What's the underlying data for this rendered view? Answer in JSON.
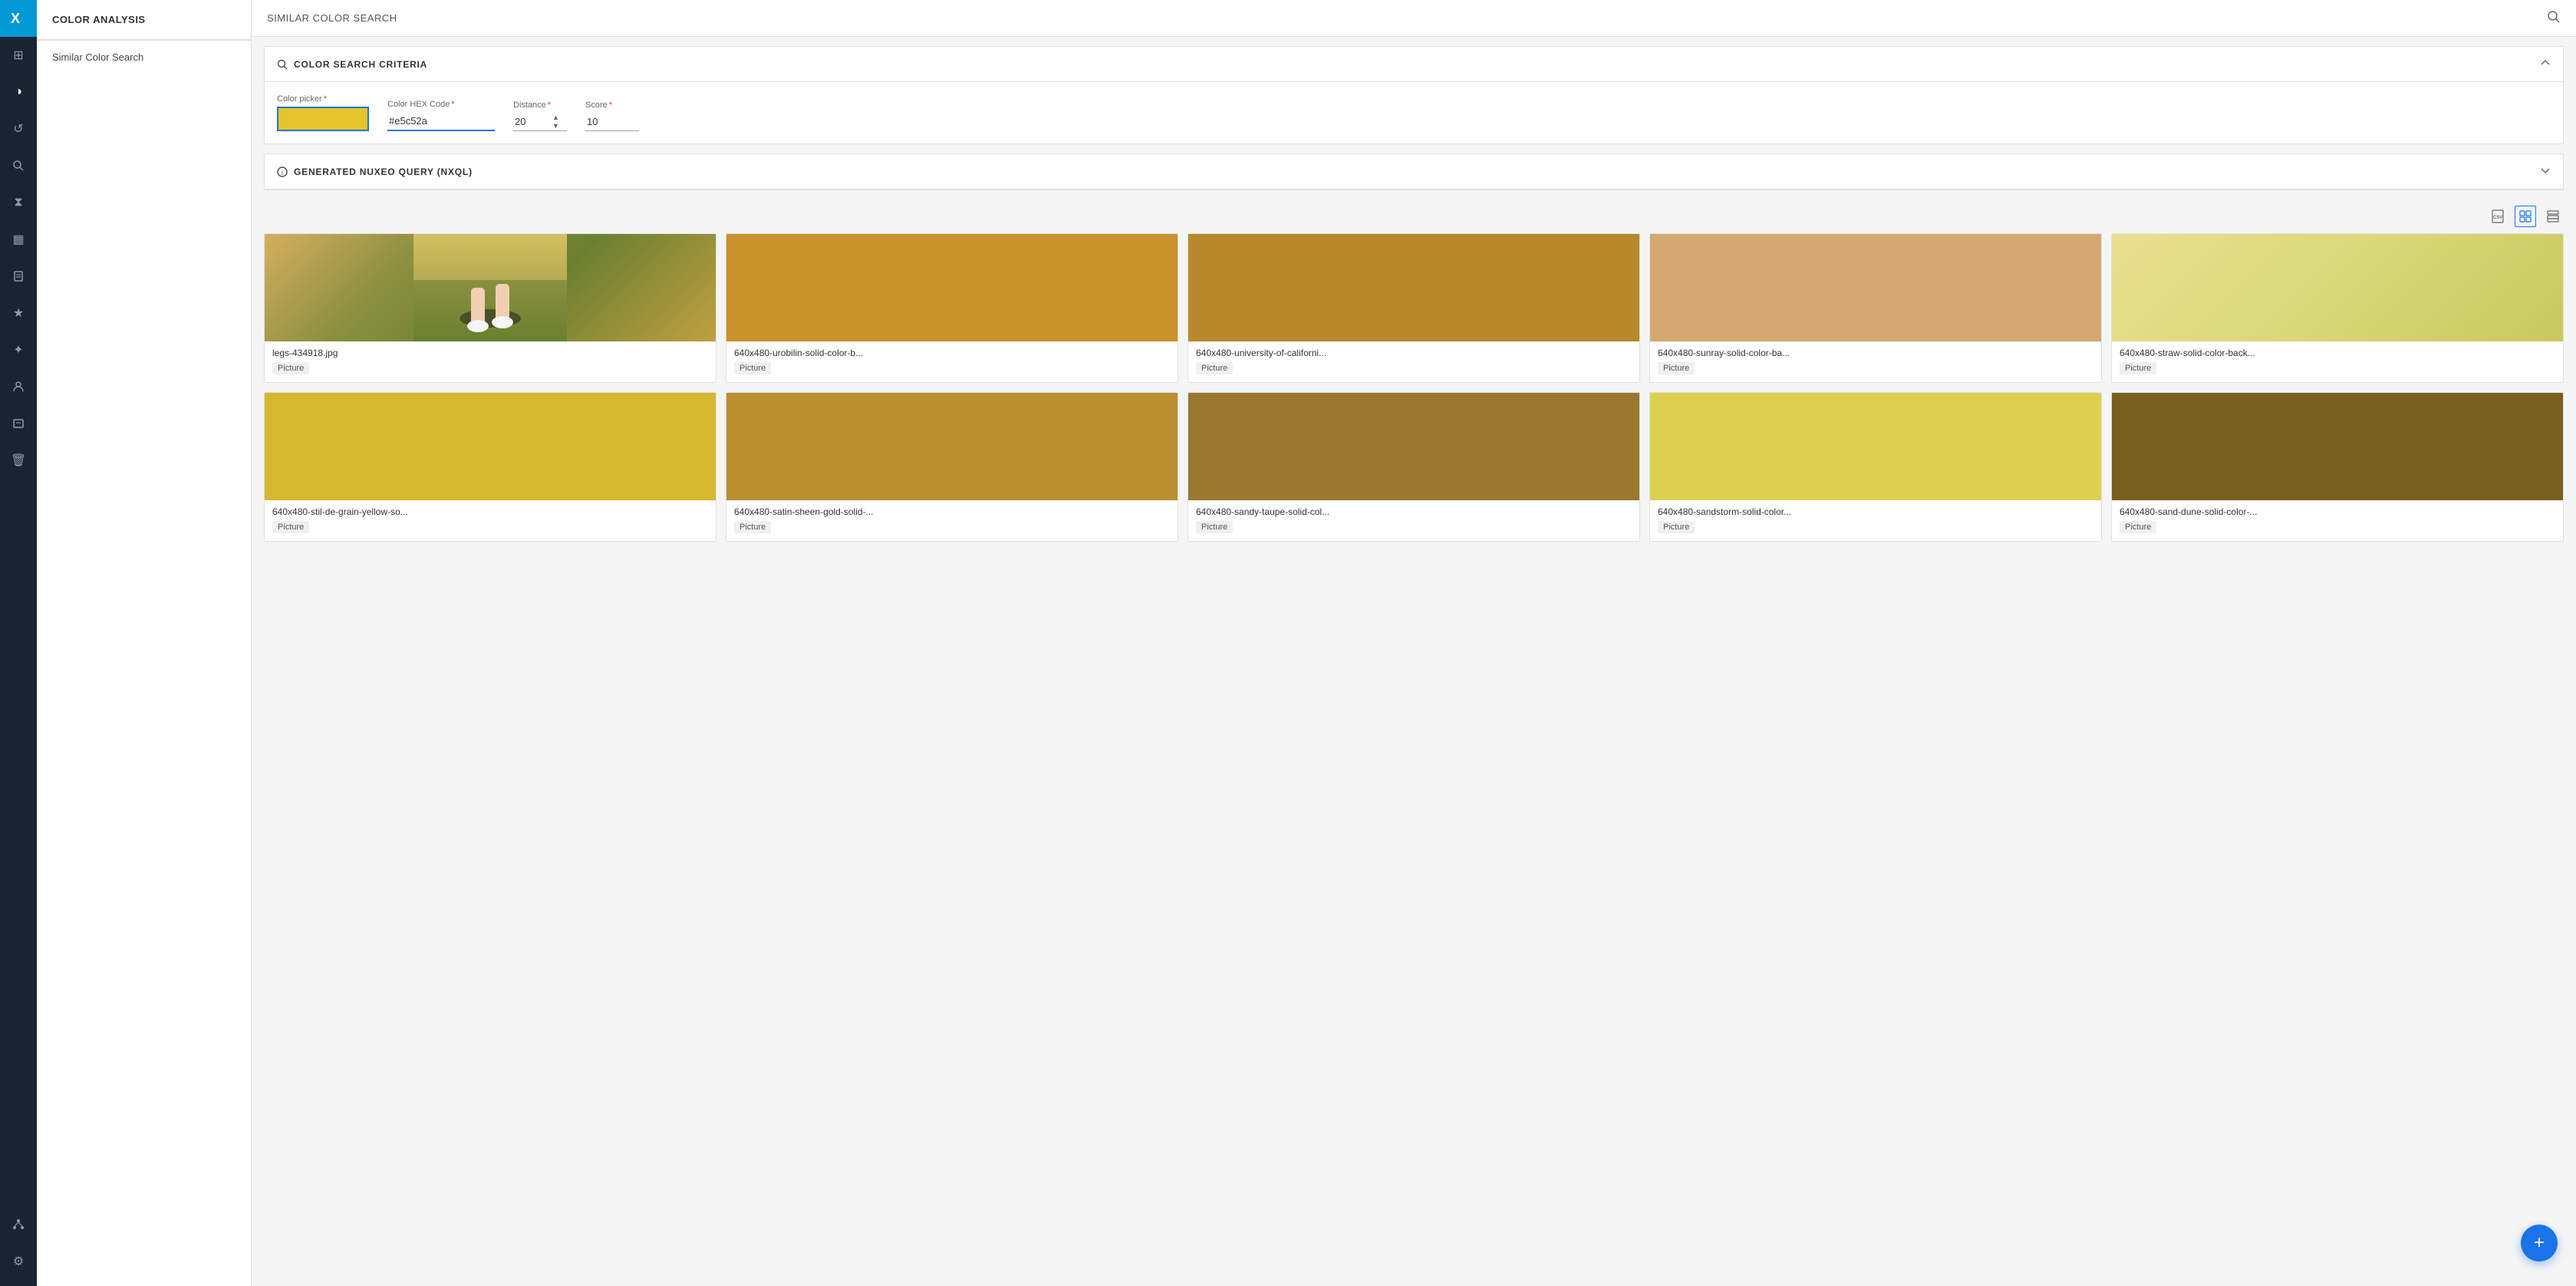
{
  "app": {
    "title": "COLOR ANALYSIS",
    "header_search_icon": "🔍"
  },
  "header": {
    "title": "SIMILAR COLOR SEARCH"
  },
  "sidebar": {
    "title": "COLOR ANALYSIS",
    "items": [
      {
        "label": "Similar Color Search",
        "active": true
      }
    ]
  },
  "nav": {
    "icons": [
      {
        "name": "home-icon",
        "glyph": "⊞",
        "active": false
      },
      {
        "name": "contrast-icon",
        "glyph": "◑",
        "active": true
      },
      {
        "name": "history-icon",
        "glyph": "↺",
        "active": false
      },
      {
        "name": "search-icon",
        "glyph": "🔍",
        "active": false
      },
      {
        "name": "timer-icon",
        "glyph": "⧗",
        "active": false
      },
      {
        "name": "gallery-icon",
        "glyph": "▦",
        "active": false
      },
      {
        "name": "clipboard-icon",
        "glyph": "📋",
        "active": false
      },
      {
        "name": "star-icon",
        "glyph": "★",
        "active": false
      },
      {
        "name": "network-icon",
        "glyph": "✦",
        "active": false
      },
      {
        "name": "user-icon",
        "glyph": "👤",
        "active": false
      },
      {
        "name": "badge-icon",
        "glyph": "🪪",
        "active": false
      },
      {
        "name": "trash-icon",
        "glyph": "🗑",
        "active": false
      }
    ],
    "bottom_icons": [
      {
        "name": "hierarchy-icon",
        "glyph": "⬡"
      },
      {
        "name": "settings-icon",
        "glyph": "⚙"
      }
    ]
  },
  "criteria_section": {
    "title": "COLOR SEARCH CRITERIA",
    "fields": {
      "color_picker_label": "Color picker",
      "color_hex_label": "Color HEX Code",
      "distance_label": "Distance",
      "score_label": "Score",
      "color_value": "#e5c52a",
      "hex_value": "#e5c52a",
      "distance_value": "20",
      "score_value": "10"
    }
  },
  "query_section": {
    "title": "GENERATED NUXEO QUERY (NXQL)"
  },
  "results": {
    "images": [
      {
        "name": "legs-434918.jpg",
        "type": "Picture",
        "bg_color": null,
        "is_photo": true,
        "photo_description": "photo of legs out car window in golden field"
      },
      {
        "name": "640x480-urobilin-solid-color-b...",
        "type": "Picture",
        "bg_color": "#c9922a",
        "is_photo": false
      },
      {
        "name": "640x480-university-of-californi...",
        "type": "Picture",
        "bg_color": "#b8892a",
        "is_photo": false
      },
      {
        "name": "640x480-sunray-solid-color-ba...",
        "type": "Picture",
        "bg_color": "#d4a870",
        "is_photo": false
      },
      {
        "name": "640x480-straw-solid-color-back...",
        "type": "Picture",
        "bg_color": "#e4e08a",
        "is_photo": false
      },
      {
        "name": "640x480-stil-de-grain-yellow-so...",
        "type": "Picture",
        "bg_color": "#d4b830",
        "is_photo": false
      },
      {
        "name": "640x480-satin-sheen-gold-solid-...",
        "type": "Picture",
        "bg_color": "#b89030",
        "is_photo": false
      },
      {
        "name": "640x480-sandy-taupe-solid-col...",
        "type": "Picture",
        "bg_color": "#9a7830",
        "is_photo": false
      },
      {
        "name": "640x480-sandstorm-solid-color...",
        "type": "Picture",
        "bg_color": "#ddd050",
        "is_photo": false
      },
      {
        "name": "640x480-sand-dune-solid-color-...",
        "type": "Picture",
        "bg_color": "#7a6020",
        "is_photo": false
      }
    ]
  },
  "fab": {
    "icon": "+",
    "label": "Add"
  }
}
